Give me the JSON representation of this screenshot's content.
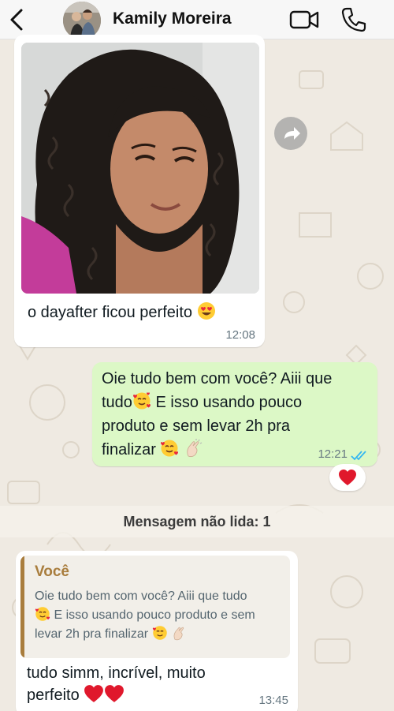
{
  "header": {
    "contact_name": "Kamily Moreira",
    "icons": [
      "back-chevron-icon",
      "video-call-icon",
      "phone-call-icon"
    ]
  },
  "messages": {
    "incoming_photo": {
      "caption": "o dayafter ficou perfeito",
      "caption_emoji": "heart-eyes",
      "time": "12:08"
    },
    "outgoing": {
      "line1": "Oie tudo bem com você? Aiii que",
      "line2a": "tudo",
      "line2b": " E isso usando pouco",
      "line3": "produto e sem levar 2h pra",
      "line4": "finalizar",
      "time": "12:21",
      "status": "read",
      "reaction": "red-heart"
    },
    "unread_banner": "Mensagem não lida: 1",
    "incoming_reply": {
      "quote_author": "Você",
      "quote_line1": "Oie tudo bem com você? Aiii que tudo",
      "quote_line2": " E isso usando pouco produto e sem",
      "quote_line3": "levar 2h pra finalizar",
      "line1": "tudo simm, incrível, muito",
      "line2": "perfeito",
      "time": "13:45"
    }
  },
  "colors": {
    "outgoing_bubble": "#dcf8c6",
    "incoming_bubble": "#ffffff",
    "quote_accent": "#a97d3d",
    "read_ticks": "#34b7f1",
    "background": "#efeae2"
  }
}
